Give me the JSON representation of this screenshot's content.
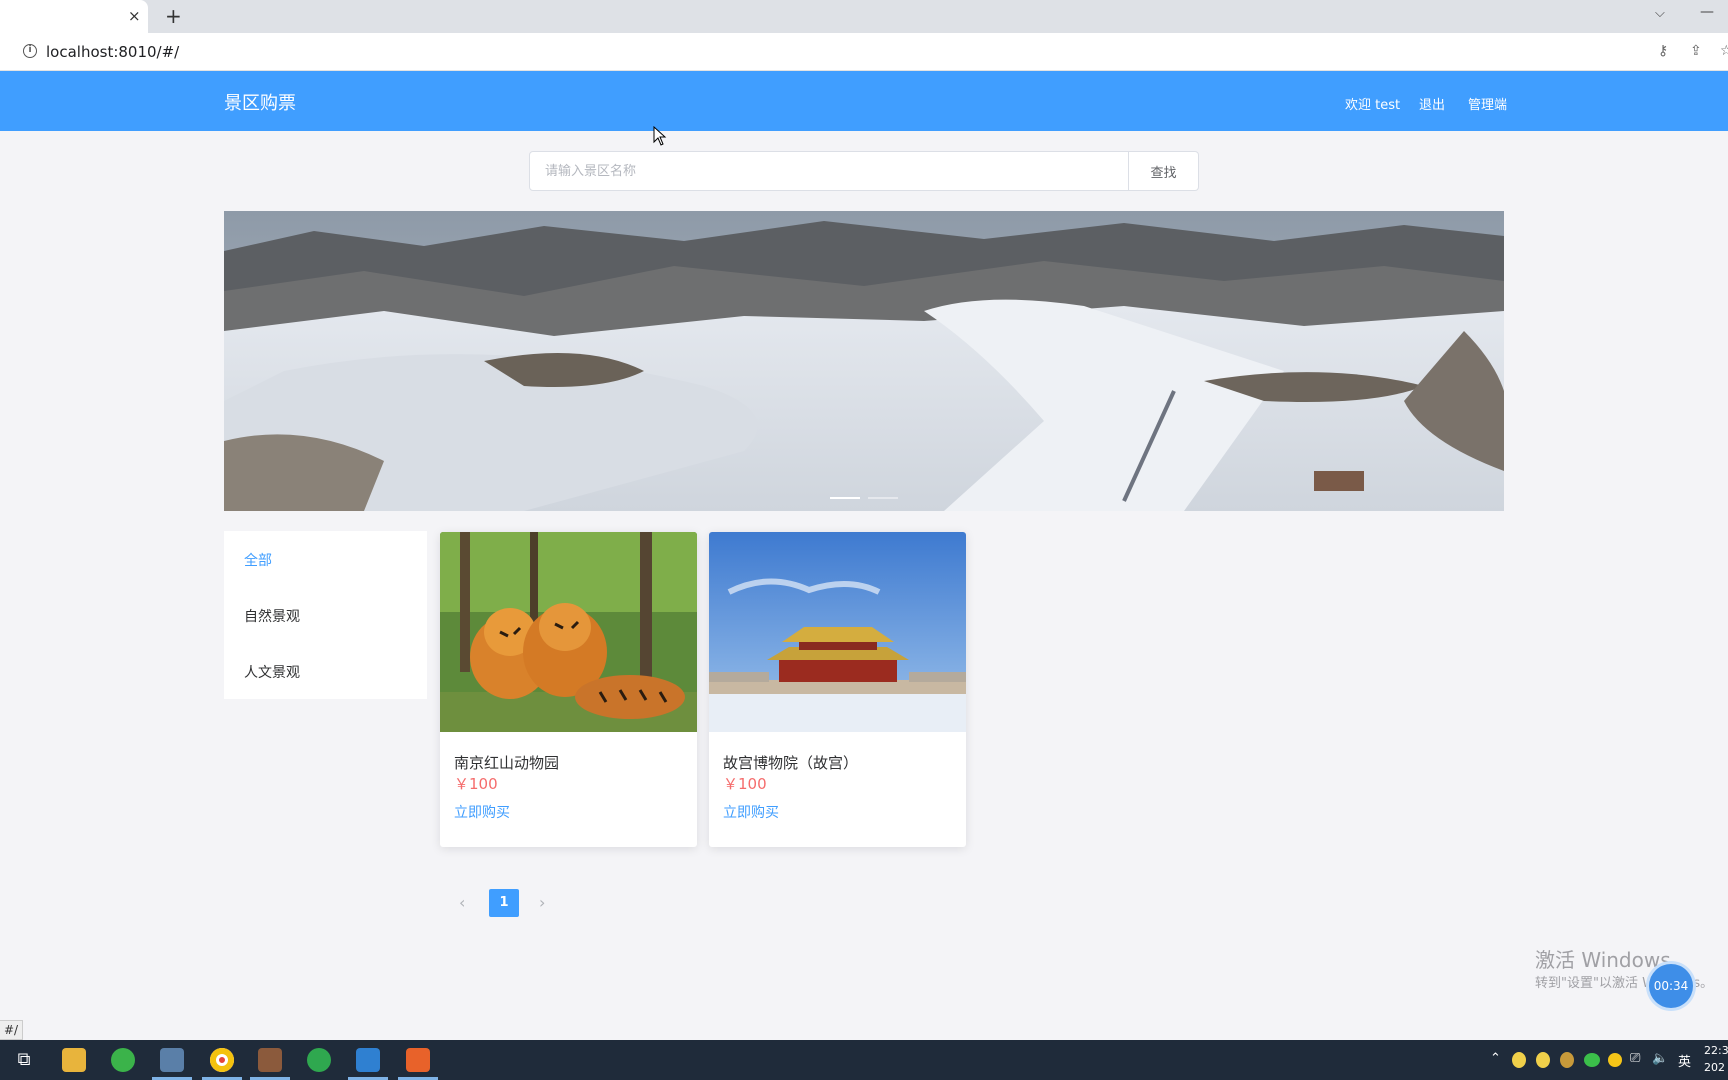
{
  "browser": {
    "tab_close": "×",
    "tab_new": "+",
    "url": "localhost:8010/#/",
    "status_url": "#/"
  },
  "header": {
    "brand": "景区购票",
    "welcome": "欢迎 test",
    "logout": "退出",
    "admin": "管理端",
    "accent": "#409eff"
  },
  "search": {
    "placeholder": "请输入景区名称",
    "button": "查找"
  },
  "carousel": {
    "slide_count": 2,
    "active_index": 0
  },
  "categories": {
    "items": [
      {
        "label": "全部",
        "active": true
      },
      {
        "label": "自然景观",
        "active": false
      },
      {
        "label": "人文景观",
        "active": false
      }
    ]
  },
  "cards": [
    {
      "title": "南京红山动物园",
      "price": "￥100",
      "action": "立即购买"
    },
    {
      "title": "故宫博物院（故宫）",
      "price": "￥100",
      "action": "立即购买"
    }
  ],
  "pagination": {
    "prev_icon": "‹",
    "current": "1",
    "next_icon": "›"
  },
  "overlay": {
    "activate_title": "激活 Windows",
    "activate_sub": "转到\"设置\"以激活 Windows。",
    "timer": "00:34"
  },
  "taskbar": {
    "lang": "英",
    "clock_line1": "22:3",
    "clock_line2": "202"
  }
}
